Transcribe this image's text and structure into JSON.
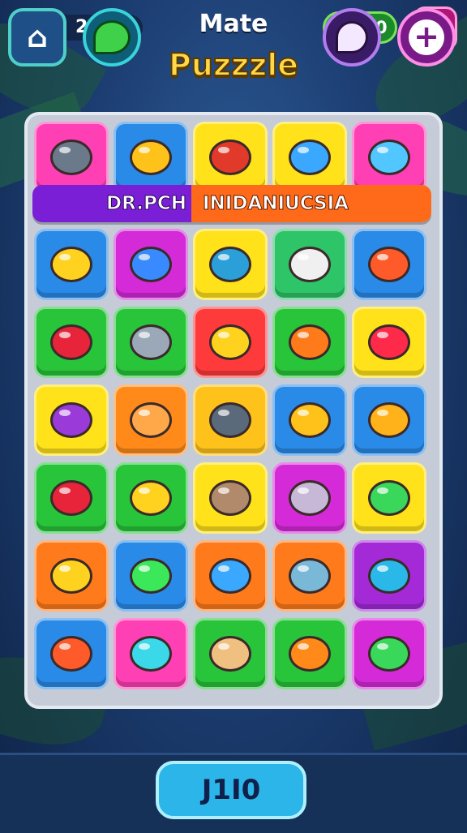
{
  "top_bar": {
    "coins": "210",
    "title_line1": "Mate",
    "title_line2": "Puzzzle",
    "stars": "L00"
  },
  "banner": {
    "left_text": "DR.PCH",
    "right_text": "INIDANIUCSIA"
  },
  "board": {
    "rows": [
      [
        {
          "color": "#ff3fb4",
          "gem": "#6a7a8a"
        },
        {
          "color": "#2a8ae8",
          "gem": "#ffc21a"
        },
        {
          "color": "#ffe21a",
          "gem": "#e23a2a"
        },
        {
          "color": "#ffe21a",
          "gem": "#3aa8ff"
        },
        {
          "color": "#ff3fb4",
          "gem": "#52c6ff"
        }
      ],
      [
        {
          "color": "#2a8ae8",
          "gem": "#ffd21f"
        },
        {
          "color": "#d42ad8",
          "gem": "#3a8aff"
        },
        {
          "color": "#ffe21a",
          "gem": "#2a9fd8"
        },
        {
          "color": "#2ec468",
          "gem": "#f0f0f0"
        },
        {
          "color": "#2a8ae8",
          "gem": "#ff5a2a"
        }
      ],
      [
        {
          "color": "#28c43a",
          "gem": "#e8243a"
        },
        {
          "color": "#28c43a",
          "gem": "#9aa8b8"
        },
        {
          "color": "#ff3a3a",
          "gem": "#ffd21f"
        },
        {
          "color": "#28c43a",
          "gem": "#ff7a1a"
        },
        {
          "color": "#ffe21a",
          "gem": "#ff2a4a"
        }
      ],
      [
        {
          "color": "#ffe21a",
          "gem": "#9a3ad8"
        },
        {
          "color": "#ff8a1a",
          "gem": "#ffa84a"
        },
        {
          "color": "#ffc21a",
          "gem": "#5a6a7a"
        },
        {
          "color": "#2a8ae8",
          "gem": "#ffc21a"
        },
        {
          "color": "#2a8ae8",
          "gem": "#ffb21a"
        }
      ],
      [
        {
          "color": "#28c43a",
          "gem": "#e8243a"
        },
        {
          "color": "#28c43a",
          "gem": "#ffd21f"
        },
        {
          "color": "#ffe21a",
          "gem": "#b08a6a"
        },
        {
          "color": "#d42ad8",
          "gem": "#c8b8d8"
        },
        {
          "color": "#ffe21a",
          "gem": "#3ad85a"
        }
      ],
      [
        {
          "color": "#ff7a1a",
          "gem": "#ffd21f"
        },
        {
          "color": "#2a8ae8",
          "gem": "#3ae85a"
        },
        {
          "color": "#ff7a1a",
          "gem": "#3aa8ff"
        },
        {
          "color": "#ff7a1a",
          "gem": "#7ab8d8"
        },
        {
          "color": "#a42ad8",
          "gem": "#2ab8e8"
        }
      ],
      [
        {
          "color": "#2a8ae8",
          "gem": "#ff5a2a"
        },
        {
          "color": "#ff3fb4",
          "gem": "#3ad8e8"
        },
        {
          "color": "#28c43a",
          "gem": "#f0c080"
        },
        {
          "color": "#28c43a",
          "gem": "#ff8a1a"
        },
        {
          "color": "#d42ad8",
          "gem": "#3ad85a"
        }
      ]
    ]
  },
  "bottom_bar": {
    "center_value": "J1I0"
  }
}
